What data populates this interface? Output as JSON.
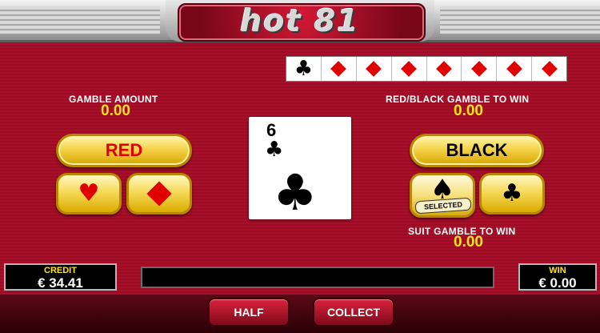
{
  "header": {
    "logo_text": "hot 81"
  },
  "history": {
    "cards": [
      "club",
      "diamond",
      "diamond",
      "diamond",
      "diamond",
      "diamond",
      "diamond",
      "diamond"
    ]
  },
  "gamble_amount": {
    "label": "GAMBLE AMOUNT",
    "value": "0.00"
  },
  "red_black": {
    "label": "RED/BLACK GAMBLE TO WIN",
    "value": "0.00"
  },
  "suit_gamble": {
    "label": "SUIT GAMBLE TO WIN",
    "value": "0.00"
  },
  "buttons": {
    "red": "RED",
    "black": "BLACK",
    "selected_badge": "SELECTED",
    "half": "HALF",
    "collect": "COLLECT"
  },
  "suits": {
    "heart": "heart-icon",
    "diamond": "diamond-icon",
    "spade": "spade-icon",
    "club": "club-icon",
    "selected": "spade"
  },
  "card": {
    "rank": "6",
    "suit": "club"
  },
  "credit": {
    "label": "CREDIT",
    "value": "€ 34.41"
  },
  "win": {
    "label": "WIN",
    "value": "€ 0.00"
  },
  "message": "",
  "colors": {
    "accent_yellow": "#ffe21a",
    "bg_red": "#a00f28",
    "suit_red": "#e00000"
  }
}
